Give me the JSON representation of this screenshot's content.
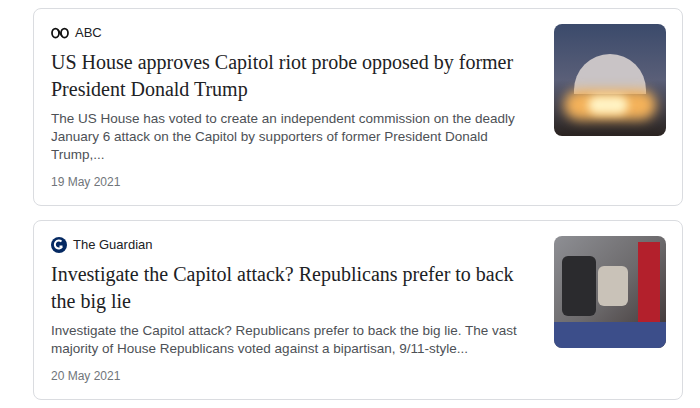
{
  "results": [
    {
      "kind": "abc",
      "source": "ABC",
      "headline": "US House approves Capitol riot probe opposed by former President Donald Trump",
      "snippet": "The US House has voted to create an independent commission on the deadly January 6 attack on the Capitol by supporters of former President Donald Trump,...",
      "date": "19 May 2021"
    },
    {
      "kind": "guardian",
      "source": "The Guardian",
      "headline": "Investigate the Capitol attack? Republicans prefer to back the big lie",
      "snippet": "Investigate the Capitol attack? Republicans prefer to back the big lie. The vast majority of House Republicans voted against a bipartisan, 9/11-style...",
      "date": "20 May 2021"
    }
  ]
}
